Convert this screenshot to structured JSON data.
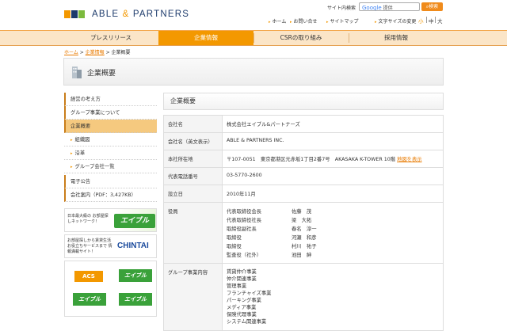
{
  "header": {
    "logo_text": "ABLE",
    "logo_amp": "&",
    "logo_text2": "PARTNERS",
    "logo_colors": [
      "#f39800",
      "#1c3a6b",
      "#7cba3d"
    ],
    "search_label": "サイト内検索",
    "search_google": "Google",
    "search_placeholder": "提供",
    "search_button": "検索",
    "links": [
      "ホーム",
      "お問い合せ",
      "サイトマップ"
    ],
    "fontsize_label": "文字サイズの変更",
    "fontsize_options": [
      "小",
      "中",
      "大"
    ]
  },
  "nav": {
    "items": [
      "プレスリリース",
      "企業情報",
      "CSRの取り組み",
      "採用情報"
    ],
    "active_index": 1,
    "accent": "#f39800"
  },
  "breadcrumb": {
    "items": [
      "ホーム",
      "企業情報",
      "企業概要"
    ]
  },
  "page_title": "企業概要",
  "sidebar": {
    "items": [
      {
        "label": "経営の考え方",
        "type": "main"
      },
      {
        "label": "グループ事業について",
        "type": "main"
      },
      {
        "label": "企業概要",
        "type": "main",
        "active": true
      },
      {
        "label": "組織図",
        "type": "sub"
      },
      {
        "label": "沿革",
        "type": "sub"
      },
      {
        "label": "グループ会社一覧",
        "type": "sub"
      },
      {
        "label": "電子公告",
        "type": "main"
      },
      {
        "label": "会社案内（PDF：3,427KB）",
        "type": "main"
      }
    ],
    "banners": [
      {
        "text": "日本最大級の お部屋探しネットワーク！",
        "brand": "エイブル"
      },
      {
        "text": "お部屋探しから賃貸生活 お役立ちサービスまで 情報満載サイト！",
        "brand": "CHINTAI"
      },
      {
        "brands": [
          "ACS",
          "エイブル",
          "エイブル",
          "エイブル"
        ]
      }
    ]
  },
  "content": {
    "heading": "企業概要",
    "rows": [
      {
        "key": "会社名",
        "value": "株式会社エイブル&パートナーズ"
      },
      {
        "key": "会社名（英文表示）",
        "value": "ABLE & PARTNERS INC."
      },
      {
        "key": "本社所在地",
        "value": "〒107-0051　東京都港区元赤坂1丁目2番7号　AKASAKA K-TOWER 10階",
        "link": "地図を表示"
      },
      {
        "key": "代表電話番号",
        "value": "03-5770-2600"
      },
      {
        "key": "設立日",
        "value": "2010年11月"
      },
      {
        "key": "役員",
        "officers": [
          {
            "title": "代表取締役会長",
            "name": "佐藤　茂"
          },
          {
            "title": "代表取締役社長",
            "name": "梁　大拓"
          },
          {
            "title": "取締役副社長",
            "name": "春名　淳一"
          },
          {
            "title": "取締役",
            "name": "河瀬　和彦"
          },
          {
            "title": "取締役",
            "name": "村川　祐子"
          },
          {
            "title": "監査役（社外）",
            "name": "池田　紳"
          }
        ]
      },
      {
        "key": "グループ事業内容",
        "list": [
          "賃貸仲介事業",
          "仲介関連事業",
          "管理事業",
          "フランチャイズ事業",
          "パーキング事業",
          "メディア事業",
          "保険代理事業",
          "システム関連事業"
        ]
      }
    ]
  }
}
